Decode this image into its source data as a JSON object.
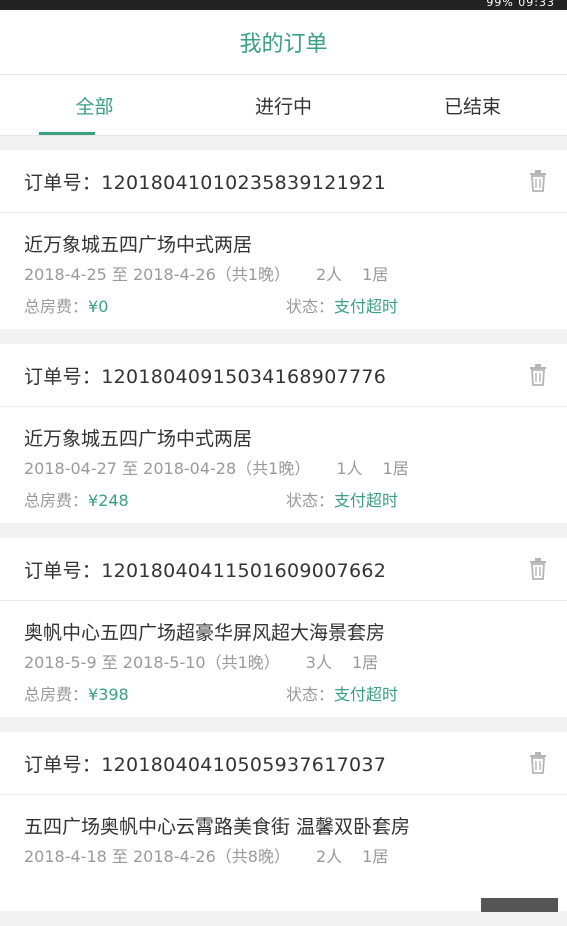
{
  "status_bar": {
    "battery": "99%",
    "time": "09:33"
  },
  "header": {
    "title": "我的订单"
  },
  "tabs": [
    {
      "label": "全部",
      "active": true
    },
    {
      "label": "进行中",
      "active": false
    },
    {
      "label": "已结束",
      "active": false
    }
  ],
  "labels": {
    "order_no": "订单号：",
    "total": "总房费：",
    "status": "状态："
  },
  "orders": [
    {
      "order_no": "1201804101023583912192​1",
      "room": "近万象城五四广场中式两居",
      "dates": "2018-4-25 至 2018-4-26（共1晚）",
      "guests": "2人",
      "rooms": "1居",
      "price": "¥0",
      "status": "支付超时"
    },
    {
      "order_no": "1201804091503416890777​6",
      "room": "近万象城五四广场中式两居",
      "dates": "2018-04-27 至 2018-04-28（共1晚）",
      "guests": "1人",
      "rooms": "1居",
      "price": "¥248",
      "status": "支付超时"
    },
    {
      "order_no": "1201804041150160900766​2",
      "room": "奥帆中心五四广场超豪华屏风超大海景套房",
      "dates": "2018-5-9 至 2018-5-10（共1晚）",
      "guests": "3人",
      "rooms": "1居",
      "price": "¥398",
      "status": "支付超时"
    },
    {
      "order_no": "1201804041050593761703​7",
      "room": "五四广场奥帆中心云霄路美食街 温馨双卧套房",
      "dates": "2018-4-18 至 2018-4-26（共8晚）",
      "guests": "2人",
      "rooms": "1居",
      "price": "",
      "status": ""
    }
  ],
  "colors": {
    "accent": "#3aa17e"
  }
}
